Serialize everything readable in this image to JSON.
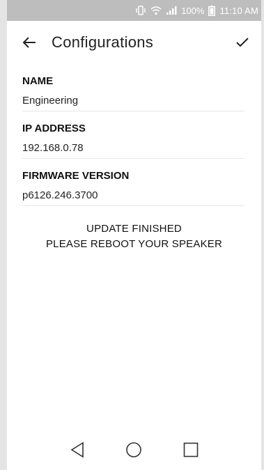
{
  "status_bar": {
    "battery": "100%",
    "time": "11:10 AM",
    "icons": [
      "vibrate-icon",
      "wifi-icon",
      "signal-icon",
      "battery-icon"
    ]
  },
  "app_bar": {
    "title": "Configurations",
    "back_icon": "arrow-left-icon",
    "confirm_icon": "checkmark-icon"
  },
  "fields": {
    "name": {
      "label": "NAME",
      "value": "Engineering"
    },
    "ip": {
      "label": "IP ADDRESS",
      "value": "192.168.0.78"
    },
    "firmware": {
      "label": "FIRMWARE VERSION",
      "value": "p6126.246.3700"
    }
  },
  "message": {
    "line1": "UPDATE FINISHED",
    "line2": "PLEASE REBOOT YOUR SPEAKER"
  },
  "nav": {
    "icons": [
      "back-triangle-icon",
      "home-circle-icon",
      "recents-square-icon"
    ]
  },
  "colors": {
    "status_bar": "#bdbdbd",
    "text": "#222222",
    "divider": "#e6e6e6"
  }
}
